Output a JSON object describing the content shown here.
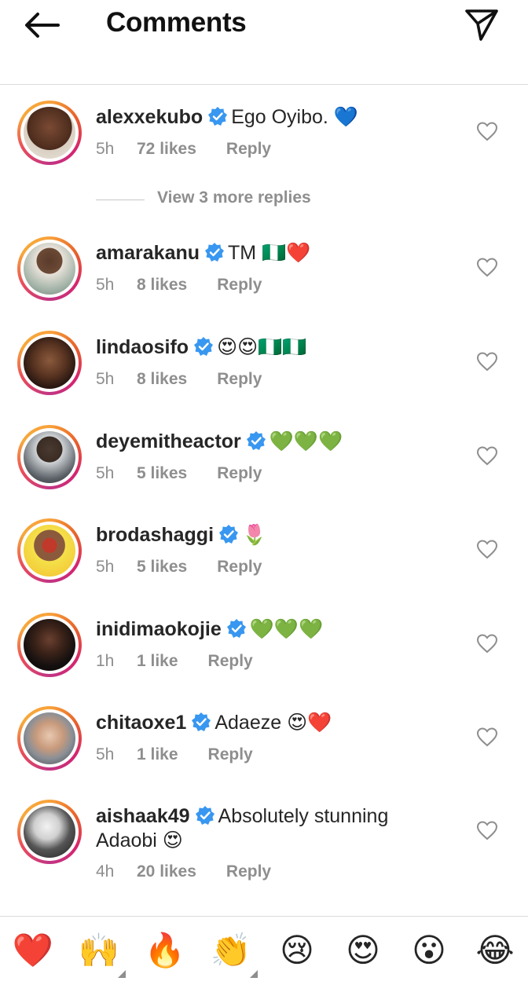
{
  "header": {
    "title": "Comments"
  },
  "comments": [
    {
      "username": "alexxekubo",
      "text": "Ego Oyibo. 💙",
      "text2": "",
      "time": "5h",
      "likes": "72 likes",
      "reply": "Reply"
    },
    {
      "username": "amarakanu",
      "text": "TM 🇳🇬❤️",
      "text2": "",
      "time": "5h",
      "likes": "8 likes",
      "reply": "Reply"
    },
    {
      "username": "lindaosifo",
      "text": "😍😍🇳🇬🇳🇬",
      "text2": "",
      "time": "5h",
      "likes": "8 likes",
      "reply": "Reply"
    },
    {
      "username": "deyemitheactor",
      "text": "💚💚💚",
      "text2": "",
      "time": "5h",
      "likes": "5 likes",
      "reply": "Reply"
    },
    {
      "username": "brodashaggi",
      "text": "🌷",
      "text2": "",
      "time": "5h",
      "likes": "5 likes",
      "reply": "Reply"
    },
    {
      "username": "inidimaokojie",
      "text": "💚💚💚",
      "text2": "",
      "time": "1h",
      "likes": "1 like",
      "reply": "Reply"
    },
    {
      "username": "chitaoxe1",
      "text": "Adaeze 😍❤️",
      "text2": "",
      "time": "5h",
      "likes": "1 like",
      "reply": "Reply"
    },
    {
      "username": "aishaak49",
      "text": "Absolutely stunning",
      "text2": "Adaobi 😍",
      "time": "4h",
      "likes": "20 likes",
      "reply": "Reply"
    }
  ],
  "view_replies": "View 3 more replies",
  "emoji_bar": [
    "❤️",
    "🙌",
    "🔥",
    "👏",
    "😢",
    "😍",
    "😮",
    "😂"
  ],
  "colors": {
    "verified": "#3897f0",
    "muted": "#8e8e8e",
    "text": "#262626"
  }
}
